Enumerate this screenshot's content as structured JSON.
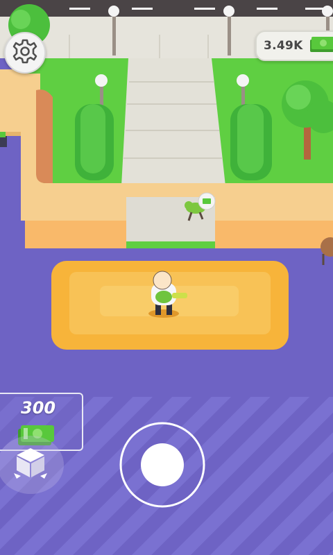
{
  "hud": {
    "money": "3.49K",
    "money_icon": "cash-icon",
    "settings_icon": "gear-icon"
  },
  "purchase": {
    "price": "300",
    "cash_icon": "cash-icon",
    "action_icon": "box-icon"
  },
  "controls": {
    "joystick_icon": "joystick"
  },
  "colors": {
    "floor": "#6e63c4",
    "grass": "#5fcf42",
    "wall": "#f6cf8f",
    "mat": "#f7b43a",
    "cash": "#58c83c",
    "road": "#4a4446"
  }
}
